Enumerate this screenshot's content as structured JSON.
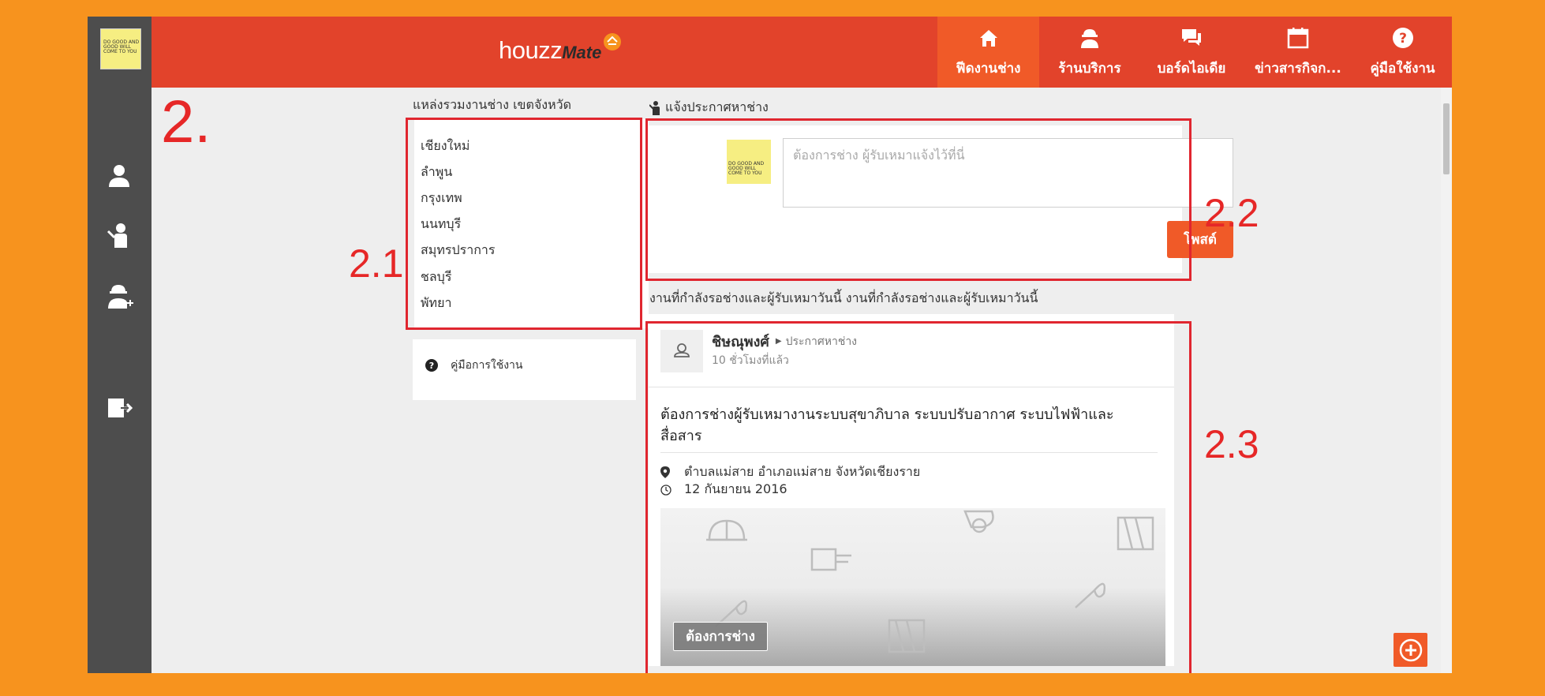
{
  "sidebar": {
    "logo_text": "DO GOOD AND GOOD WILL COME TO YOU",
    "icons": [
      "user-icon",
      "worker-icon",
      "add-technician-icon",
      "logout-icon"
    ]
  },
  "header": {
    "brand_main": "houzz",
    "brand_sub": "Mate",
    "nav": [
      {
        "label": "ฟีดงานช่าง",
        "icon": "home-icon",
        "active": true
      },
      {
        "label": "ร้านบริการ",
        "icon": "technician-icon",
        "active": false
      },
      {
        "label": "บอร์ดไอเดีย",
        "icon": "chat-icon",
        "active": false
      },
      {
        "label": "ข่าวสารกิจก...",
        "icon": "calendar-icon",
        "active": false
      },
      {
        "label": "คู่มือใช้งาน",
        "icon": "help-icon",
        "active": false
      }
    ]
  },
  "annotations": {
    "section": "2.",
    "provinces_box": "2.1",
    "post_box": "2.2",
    "feed_box": "2.3"
  },
  "provinces": {
    "title": "แหล่งรวมงานช่าง เขตจังหวัด",
    "items": [
      "เชียงใหม่",
      "ลำพูน",
      "กรุงเทพ",
      "นนทบุรี",
      "สมุทรปราการ",
      "ชลบุรี",
      "พัทยา"
    ]
  },
  "help_link": {
    "label": "คู่มือการใช้งาน",
    "icon": "question-circle-icon"
  },
  "post": {
    "title": "แจ้งประกาศหาช่าง",
    "avatar_text": "DO GOOD AND GOOD WILL COME TO YOU",
    "placeholder": "ต้องการช่าง ผู้รับเหมาแจ้งไว้ที่นี่",
    "button": "โพสต์"
  },
  "feed": {
    "title": "งานที่กำลังรอช่างและผู้รับเหมาวันนี้ งานที่กำลังรอช่างและผู้รับเหมาวันนี้",
    "card": {
      "author": "ชิษณุพงศ์",
      "type": "ประกาศหาช่าง",
      "time": "10 ชั่วโมงที่แล้ว",
      "body_line1": "ต้องการช่างผู้รับเหมางานระบบสุขาภิบาล ระบบปรับอากาศ ระบบไฟฟ้าและ",
      "body_line2": "สื่อสาร",
      "location": "ตำบลแม่สาย อำเภอแม่สาย จังหวัดเชียงราย",
      "date": "12 กันยายน 2016",
      "badge": "ต้องการช่าง"
    }
  },
  "colors": {
    "background": "#f7931e",
    "topbar": "#e2432b",
    "active_nav": "#f05a28",
    "sidebar": "#4d4d4d",
    "annotation": "#e0262f"
  }
}
